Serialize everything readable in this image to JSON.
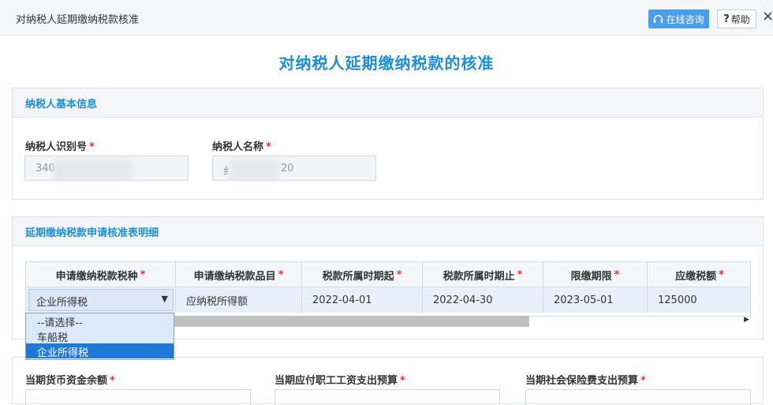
{
  "window": {
    "title": "对纳税人延期缴纳税款核准",
    "online_label": "在线咨询",
    "help_label": "帮助",
    "close_label": "×"
  },
  "page_title": "对纳税人延期缴纳税款的核准",
  "basic_info": {
    "section_title": "纳税人基本信息",
    "taxpayer_id_label": "纳税人识别号",
    "taxpayer_id_value": "340",
    "taxpayer_name_label": "纳税人名称",
    "taxpayer_name_value": "纟",
    "taxpayer_name_tail": "20",
    "required_mark": "*"
  },
  "detail": {
    "section_title": "延期缴纳税款申请核准表明细",
    "columns": [
      "申请缴纳税款税种",
      "申请缴纳税款品目",
      "税款所属时期起",
      "税款所属时期止",
      "限缴期限",
      "应缴税额"
    ],
    "row": {
      "tax_type": "企业所得税",
      "tax_item": "应纳税所得额",
      "period_start": "2022-04-01",
      "period_end": "2022-04-30",
      "deadline": "2023-05-01",
      "amount": "125000"
    },
    "dropdown_options": [
      "--请选择--",
      "车船税",
      "企业所得税"
    ],
    "selected_option_index": 2
  },
  "bottom": {
    "fields": [
      "当期货币资金余额",
      "当期应付职工工资支出预算",
      "当期社会保险费支出预算"
    ]
  }
}
